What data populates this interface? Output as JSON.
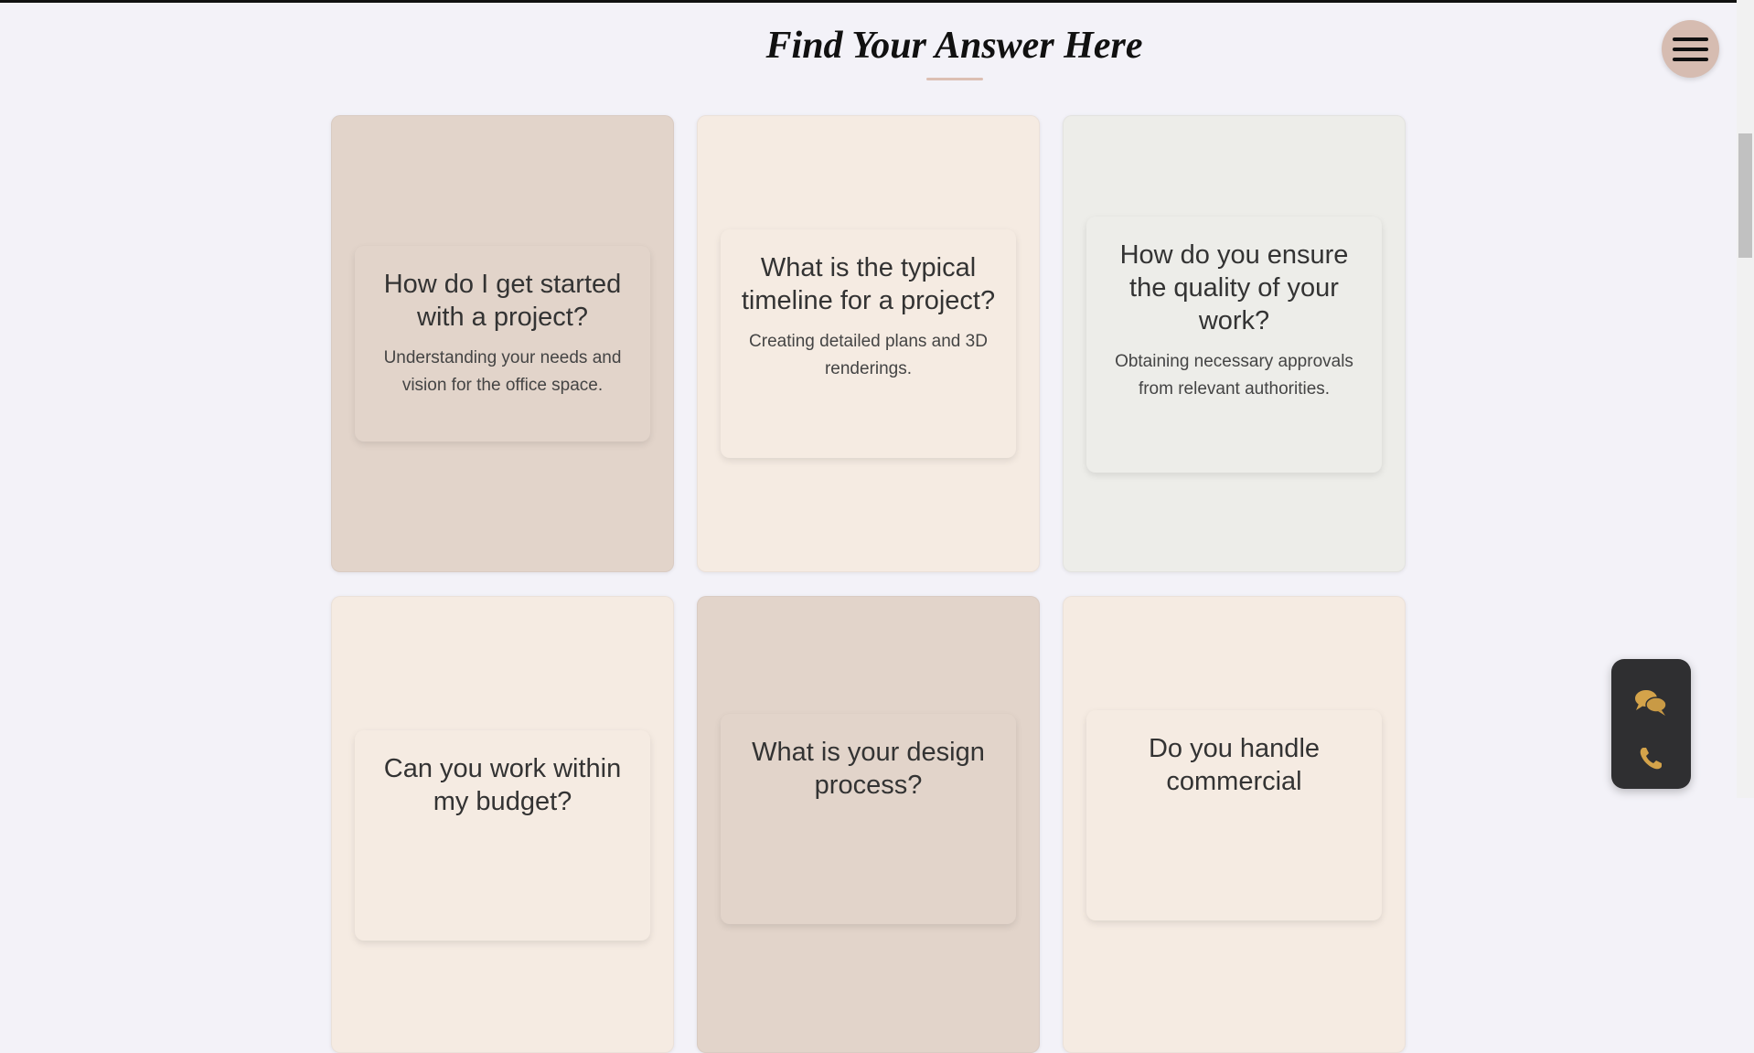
{
  "header": {
    "title": "Find Your Answer Here"
  },
  "faq": [
    {
      "question": "How do I get started with a project?",
      "answer": "Understanding your needs and vision for the office space."
    },
    {
      "question": "What is the typical timeline for a project?",
      "answer": "Creating detailed plans and 3D renderings."
    },
    {
      "question": "How do you ensure the quality of your work?",
      "answer": "Obtaining necessary approvals from relevant authorities."
    },
    {
      "question": "Can you work within my budget?",
      "answer": ""
    },
    {
      "question": "What is your design process?",
      "answer": ""
    },
    {
      "question": "Do you handle commercial",
      "answer": ""
    }
  ],
  "icons": {
    "menu": "hamburger-menu-icon",
    "chat": "chat-bubbles-icon",
    "phone": "phone-icon"
  },
  "colors": {
    "background": "#f3f2f8",
    "accent": "#d6bcb1",
    "widget": "#2f2f31",
    "widget_icon": "#d4a34a"
  }
}
